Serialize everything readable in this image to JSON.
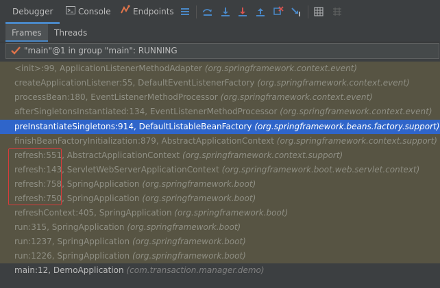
{
  "toolbar": {
    "tabs": [
      {
        "label": "Debugger",
        "active": true
      },
      {
        "label": "Console",
        "active": false,
        "icon": "console-icon"
      },
      {
        "label": "Endpoints",
        "active": false,
        "icon": "endpoints-icon"
      }
    ],
    "icons": [
      "menu-icon",
      "show-execution-point-icon",
      "step-over-icon",
      "step-into-icon",
      "force-step-into-icon",
      "step-out-icon",
      "drop-frame-icon",
      "run-to-cursor-icon",
      "evaluate-expression-icon",
      "trace-current-stream-icon"
    ]
  },
  "subtabs": [
    {
      "label": "Frames",
      "active": true
    },
    {
      "label": "Threads",
      "active": false
    }
  ],
  "thread": {
    "status_text": "\"main\"@1 in group \"main\": RUNNING"
  },
  "frames": [
    {
      "method": "<init>:99, ApplicationListenerMethodAdapter",
      "pkg": "(org.springframework.context.event)"
    },
    {
      "method": "createApplicationListener:55, DefaultEventListenerFactory",
      "pkg": "(org.springframework.context.event)"
    },
    {
      "method": "processBean:180, EventListenerMethodProcessor",
      "pkg": "(org.springframework.context.event)"
    },
    {
      "method": "afterSingletonsInstantiated:134, EventListenerMethodProcessor",
      "pkg": "(org.springframework.context.event)"
    },
    {
      "method": "preInstantiateSingletons:914, DefaultListableBeanFactory",
      "pkg": "(org.springframework.beans.factory.support)"
    },
    {
      "method": "finishBeanFactoryInitialization:879, AbstractApplicationContext",
      "pkg": "(org.springframework.context.support)"
    },
    {
      "method": "refresh:551, AbstractApplicationContext",
      "pkg": "(org.springframework.context.support)"
    },
    {
      "method": "refresh:143, ServletWebServerApplicationContext",
      "pkg": "(org.springframework.boot.web.servlet.context)"
    },
    {
      "method": "refresh:758, SpringApplication",
      "pkg": "(org.springframework.boot)"
    },
    {
      "method": "refresh:750, SpringApplication",
      "pkg": "(org.springframework.boot)"
    },
    {
      "method": "refreshContext:405, SpringApplication",
      "pkg": "(org.springframework.boot)"
    },
    {
      "method": "run:315, SpringApplication",
      "pkg": "(org.springframework.boot)"
    },
    {
      "method": "run:1237, SpringApplication",
      "pkg": "(org.springframework.boot)"
    },
    {
      "method": "run:1226, SpringApplication",
      "pkg": "(org.springframework.boot)"
    },
    {
      "method": "main:12, DemoApplication",
      "pkg": "(com.transaction.manager.demo)"
    }
  ],
  "colors": {
    "selected_row": "#2f65ca",
    "library_frame_bg": "#575443",
    "annotation_box": "#d93b3b"
  }
}
